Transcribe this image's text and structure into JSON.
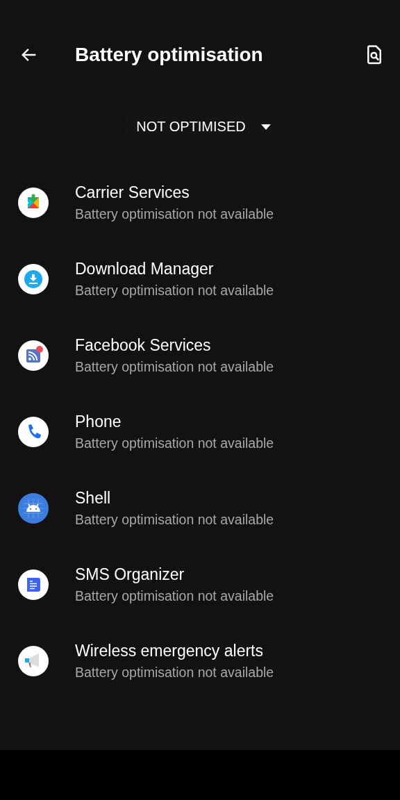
{
  "app_bar": {
    "title": "Battery optimisation"
  },
  "filter": {
    "label": "NOT OPTIMISED"
  },
  "apps": [
    {
      "kind": "puzzle",
      "name": "Carrier Services",
      "status": "Battery optimisation not available"
    },
    {
      "kind": "download",
      "name": "Download Manager",
      "status": "Battery optimisation not available"
    },
    {
      "kind": "feed",
      "name": "Facebook Services",
      "status": "Battery optimisation not available"
    },
    {
      "kind": "phone",
      "name": "Phone",
      "status": "Battery optimisation not available"
    },
    {
      "kind": "android",
      "name": "Shell",
      "status": "Battery optimisation not available"
    },
    {
      "kind": "message",
      "name": "SMS Organizer",
      "status": "Battery optimisation not available"
    },
    {
      "kind": "megaphone",
      "name": "Wireless emergency alerts",
      "status": "Battery optimisation not available"
    }
  ]
}
